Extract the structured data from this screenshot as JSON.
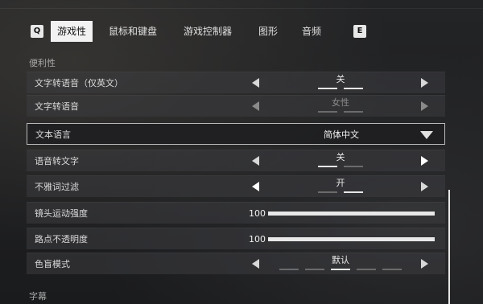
{
  "tabs": {
    "left_key": "Q",
    "right_key": "E",
    "items": [
      {
        "label": "游戏性",
        "active": true
      },
      {
        "label": "鼠标和键盘",
        "active": false
      },
      {
        "label": "游戏控制器",
        "active": false
      },
      {
        "label": "图形",
        "active": false
      },
      {
        "label": "音频",
        "active": false
      }
    ]
  },
  "sections": {
    "accessibility": "便利性",
    "subtitles": "字幕"
  },
  "settings": {
    "tts_english": {
      "label": "文字转语音（仅英文）",
      "value": "关",
      "segments": 2,
      "selected": 0
    },
    "tts_voice": {
      "label": "文字转语音",
      "value": "女性"
    },
    "text_language": {
      "label": "文本语言",
      "value": "简体中文"
    },
    "stt": {
      "label": "语音转文字",
      "value": "关",
      "segments": 2,
      "selected": 0
    },
    "profanity": {
      "label": "不雅词过滤",
      "value": "开",
      "segments": 2,
      "selected": 1
    },
    "camera_shake": {
      "label": "镜头运动强度",
      "value": "100",
      "level_percent": 100
    },
    "waypoint_opacity": {
      "label": "路点不透明度",
      "value": "100",
      "level_percent": 100
    },
    "colorblind": {
      "label": "色盲模式",
      "value": "默认",
      "segments": 5,
      "selected": 2
    }
  },
  "colors": {
    "accent": "#f2f2f2",
    "background": "#1c1d1f"
  }
}
